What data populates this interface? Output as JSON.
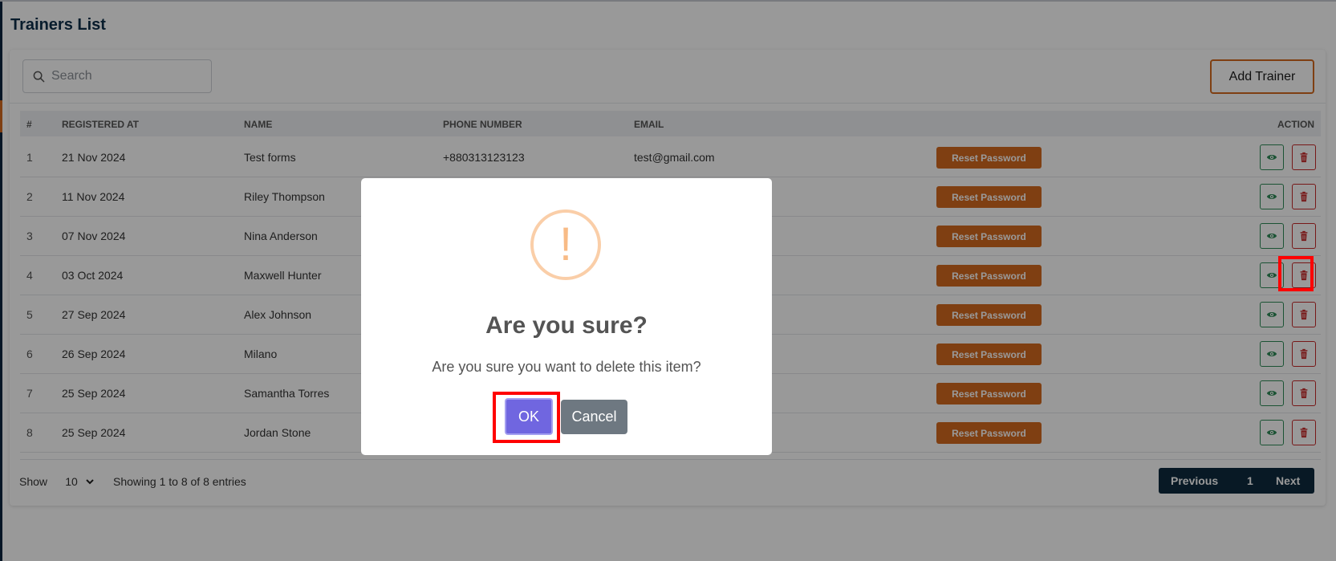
{
  "page": {
    "title": "Trainers List"
  },
  "toolbar": {
    "search_placeholder": "Search",
    "add_label": "Add Trainer"
  },
  "table": {
    "headers": [
      "#",
      "REGISTERED AT",
      "NAME",
      "PHONE NUMBER",
      "EMAIL",
      "ACTION"
    ],
    "reset_label": "Reset Password",
    "rows": [
      {
        "num": "1",
        "date": "21 Nov 2024",
        "name": "Test forms",
        "phone": "+880313123123",
        "email": "test@gmail.com"
      },
      {
        "num": "2",
        "date": "11 Nov 2024",
        "name": "Riley Thompson",
        "phone": "",
        "email": ""
      },
      {
        "num": "3",
        "date": "07 Nov 2024",
        "name": "Nina Anderson",
        "phone": "",
        "email": ""
      },
      {
        "num": "4",
        "date": "03 Oct 2024",
        "name": "Maxwell Hunter",
        "phone": "",
        "email": ""
      },
      {
        "num": "5",
        "date": "27 Sep 2024",
        "name": "Alex Johnson",
        "phone": "",
        "email": ""
      },
      {
        "num": "6",
        "date": "26 Sep 2024",
        "name": "Milano",
        "phone": "",
        "email": ""
      },
      {
        "num": "7",
        "date": "25 Sep 2024",
        "name": "Samantha Torres",
        "phone": "",
        "email": ""
      },
      {
        "num": "8",
        "date": "25 Sep 2024",
        "name": "Jordan Stone",
        "phone": "",
        "email": ""
      }
    ]
  },
  "footer": {
    "show_label": "Show",
    "page_size": "10",
    "entries_info": "Showing 1 to 8 of 8 entries",
    "prev_label": "Previous",
    "current_page": "1",
    "next_label": "Next"
  },
  "modal": {
    "icon": "!",
    "title": "Are you sure?",
    "text": "Are you sure you want to delete this item?",
    "ok_label": "OK",
    "cancel_label": "Cancel"
  },
  "colors": {
    "accent_orange": "#d46a1f",
    "navy": "#0e2a3e",
    "confirm": "#7066e0",
    "cancel": "#6e7881",
    "highlight": "#ff0000"
  }
}
